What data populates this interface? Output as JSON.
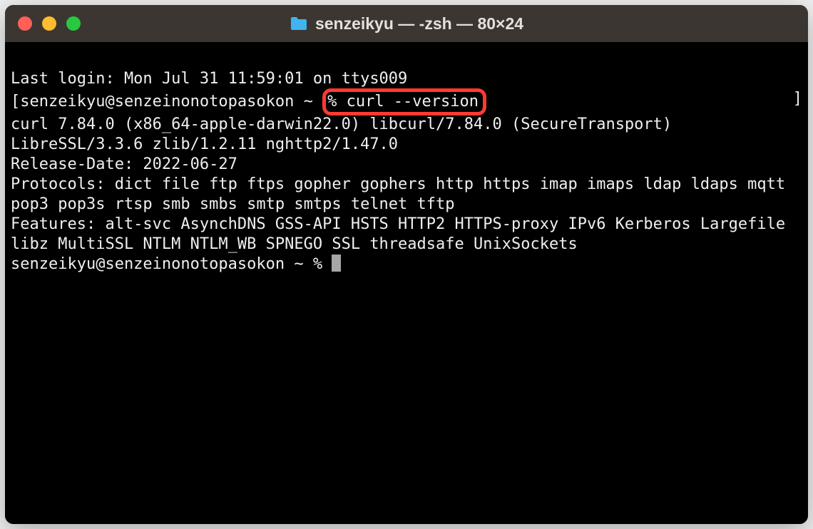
{
  "window": {
    "title": "senzeikyu — -zsh — 80×24"
  },
  "terminal": {
    "last_login_line": "Last login: Mon Jul 31 11:59:01 on ttys009",
    "prompt_prefix": "[senzeikyu@senzeinonotopasokon ~ ",
    "highlighted_command": "% curl --version",
    "bracket_close": "]",
    "output_line_1": "curl 7.84.0 (x86_64-apple-darwin22.0) libcurl/7.84.0 (SecureTransport) LibreSSL/3.3.6 zlib/1.2.11 nghttp2/1.47.0",
    "output_line_2": "Release-Date: 2022-06-27",
    "output_line_3": "Protocols: dict file ftp ftps gopher gophers http https imap imaps ldap ldaps mqtt pop3 pop3s rtsp smb smbs smtp smtps telnet tftp",
    "output_line_4": "Features: alt-svc AsynchDNS GSS-API HSTS HTTP2 HTTPS-proxy IPv6 Kerberos Largefile libz MultiSSL NTLM NTLM_WB SPNEGO SSL threadsafe UnixSockets",
    "prompt_idle": "senzeikyu@senzeinonotopasokon ~ % "
  }
}
